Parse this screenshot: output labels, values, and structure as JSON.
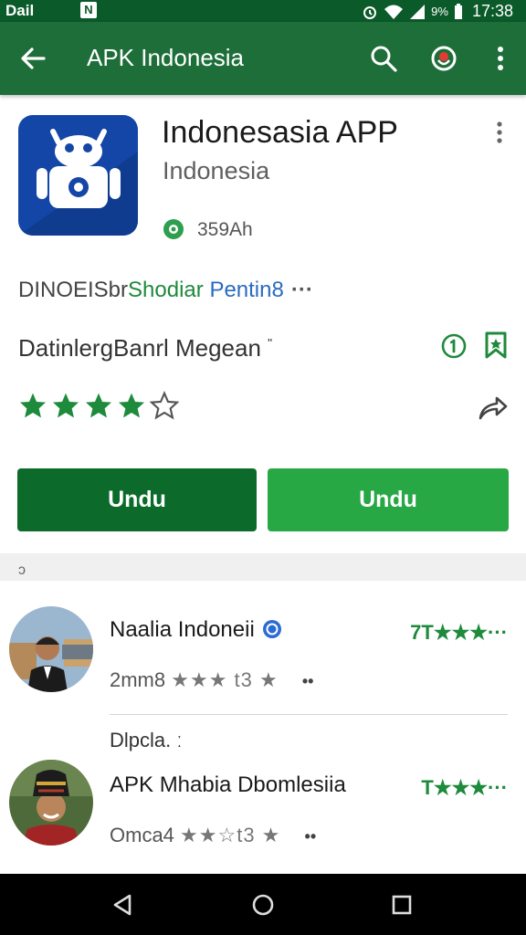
{
  "status_bar": {
    "left_text": "Dail",
    "notif_glyph": "N",
    "battery_text": "9%",
    "time": "17:38",
    "icons": [
      "alarm-icon",
      "wifi-icon",
      "signal-icon",
      "battery-icon"
    ]
  },
  "app_bar": {
    "title": "APK Indonesia",
    "icons": [
      "back-arrow-icon",
      "search-icon",
      "mic-icon",
      "more-vert-icon"
    ]
  },
  "app": {
    "name": "Indonesasia APP",
    "developer": "Indonesia",
    "size": "359Ah",
    "tag_1": "DINOEISbr",
    "tag_2": "Shodiar",
    "tag_3": "Pentin8",
    "tags_more": "···",
    "category": "DatinlergBanrl Megean",
    "category_mark": "\"",
    "rating_stars": 4,
    "rating_max": 5,
    "colors": {
      "primary_green": "#1e6e3a",
      "icon_blue": "#1446a8"
    }
  },
  "buttons": {
    "install_1": "Undu",
    "install_2": "Undu"
  },
  "divider": {
    "mark": "ɔ"
  },
  "reviews": [
    {
      "name": "Naalia Indoneii",
      "verified": true,
      "rating_text": "7T★★★···",
      "meta_text": "2mm8",
      "meta_stars": "★★★ t3 ★",
      "meta_dots": "••"
    },
    {
      "name": "APK Mhabia Dbomlesiia",
      "verified": false,
      "rating_text": "T★★★···",
      "meta_text": "Omca4",
      "meta_stars": "★★☆t3 ★",
      "meta_dots": "••"
    }
  ],
  "section_label": "Dlpcla.  ː"
}
